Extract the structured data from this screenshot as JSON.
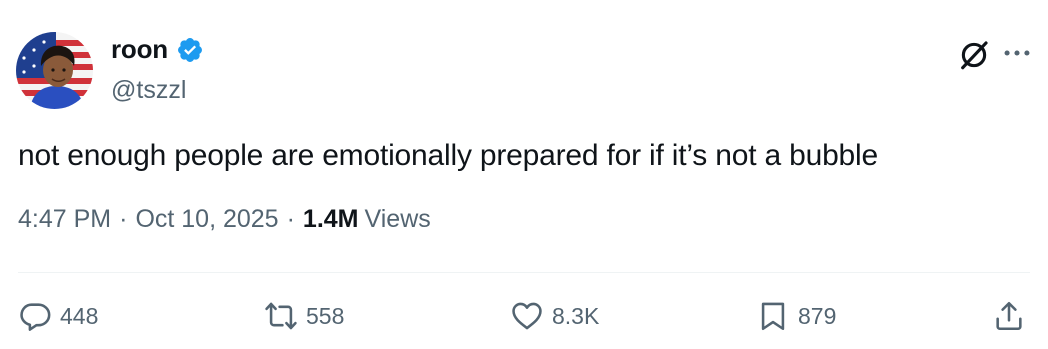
{
  "author": {
    "display_name": "roon",
    "handle": "@tszzl",
    "verified": true,
    "verified_color": "#1d9bf0"
  },
  "tweet": {
    "text": "not enough people are emotionally prepared for if it’s not a bubble",
    "time": "4:47 PM",
    "date": "Oct 10, 2025",
    "separator": "·",
    "views_count": "1.4M",
    "views_label": "Views"
  },
  "actions": {
    "replies": "448",
    "retweets": "558",
    "likes": "8.3K",
    "bookmarks": "879"
  },
  "icons": {
    "header": [
      "grok-icon",
      "more-icon"
    ],
    "actions": [
      "reply-icon",
      "retweet-icon",
      "like-icon",
      "bookmark-icon",
      "share-icon"
    ]
  },
  "colors": {
    "text_primary": "#0f1419",
    "text_secondary": "#536471",
    "divider": "#eff3f4"
  }
}
